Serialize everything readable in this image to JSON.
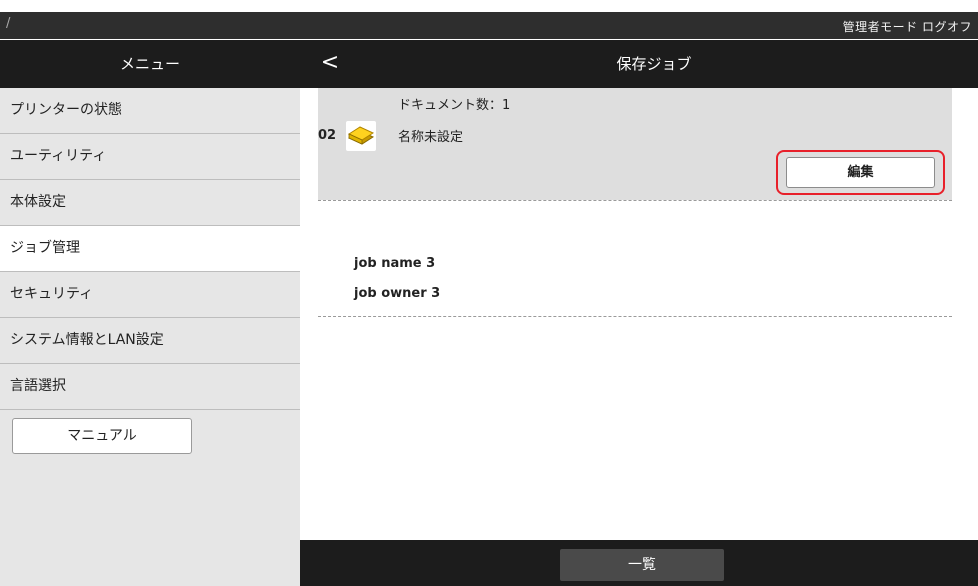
{
  "top_bar": {
    "slash": "/",
    "mode": "管理者モード ログオフ"
  },
  "header": {
    "menu_title": "メニュー",
    "back": "<",
    "page_title": "保存ジョブ"
  },
  "sidebar": {
    "items": [
      {
        "label": "プリンターの状態"
      },
      {
        "label": "ユーティリティ"
      },
      {
        "label": "本体設定"
      },
      {
        "label": "ジョブ管理"
      },
      {
        "label": "セキュリティ"
      },
      {
        "label": "システム情報とLAN設定"
      },
      {
        "label": "言語選択"
      }
    ],
    "manual_label": "マニュアル"
  },
  "jobs": [
    {
      "doc_count": "ドキュメント数：1",
      "number": "02",
      "name": "名称未設定",
      "edit_label": "編集",
      "icon": "document-stack-icon"
    },
    {
      "name": "job name 3",
      "owner": "job owner 3"
    }
  ],
  "footer": {
    "list_label": "一覧"
  },
  "colors": {
    "highlight": "#e8202a",
    "header": "#1c1c1c",
    "sidebar": "#e6e6e6"
  }
}
